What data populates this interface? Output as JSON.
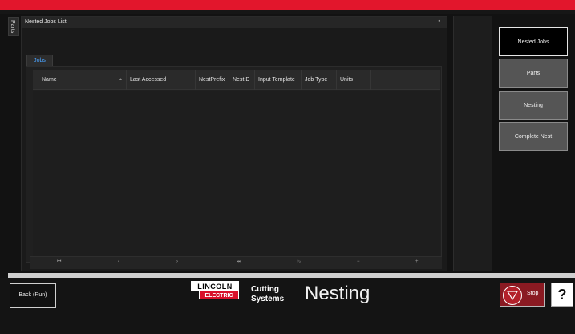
{
  "side_tab": {
    "label": "Parts"
  },
  "panel": {
    "title": "Nested Jobs List",
    "pin_icon": "pin-icon",
    "tab": "Jobs",
    "columns": [
      "Name",
      "Last Accessed",
      "NestPrefix",
      "NestID",
      "Input Template",
      "Job Type",
      "Units"
    ],
    "rows": [],
    "pager": {
      "first": "⏮",
      "prev": "‹",
      "next": "›",
      "last": "⏭",
      "refresh": "↻",
      "remove": "−",
      "add": "+"
    }
  },
  "nav": {
    "nested_jobs": "Nested Jobs",
    "parts": "Parts",
    "nesting": "Nesting",
    "complete_nest": "Complete Nest"
  },
  "bottom": {
    "back_label": "Back (Run)",
    "logo_top": "LINCOLN",
    "logo_bottom": "ELECTRIC",
    "brand_line1": "Cutting",
    "brand_line2": "Systems",
    "screen_title": "Nesting",
    "stop_label": "Stop",
    "help_label": "?"
  },
  "colors": {
    "accent_red": "#e2162c",
    "tab_blue": "#4aa3ff",
    "active_nav_bg": "#000000",
    "inactive_nav_bg": "#555555"
  }
}
